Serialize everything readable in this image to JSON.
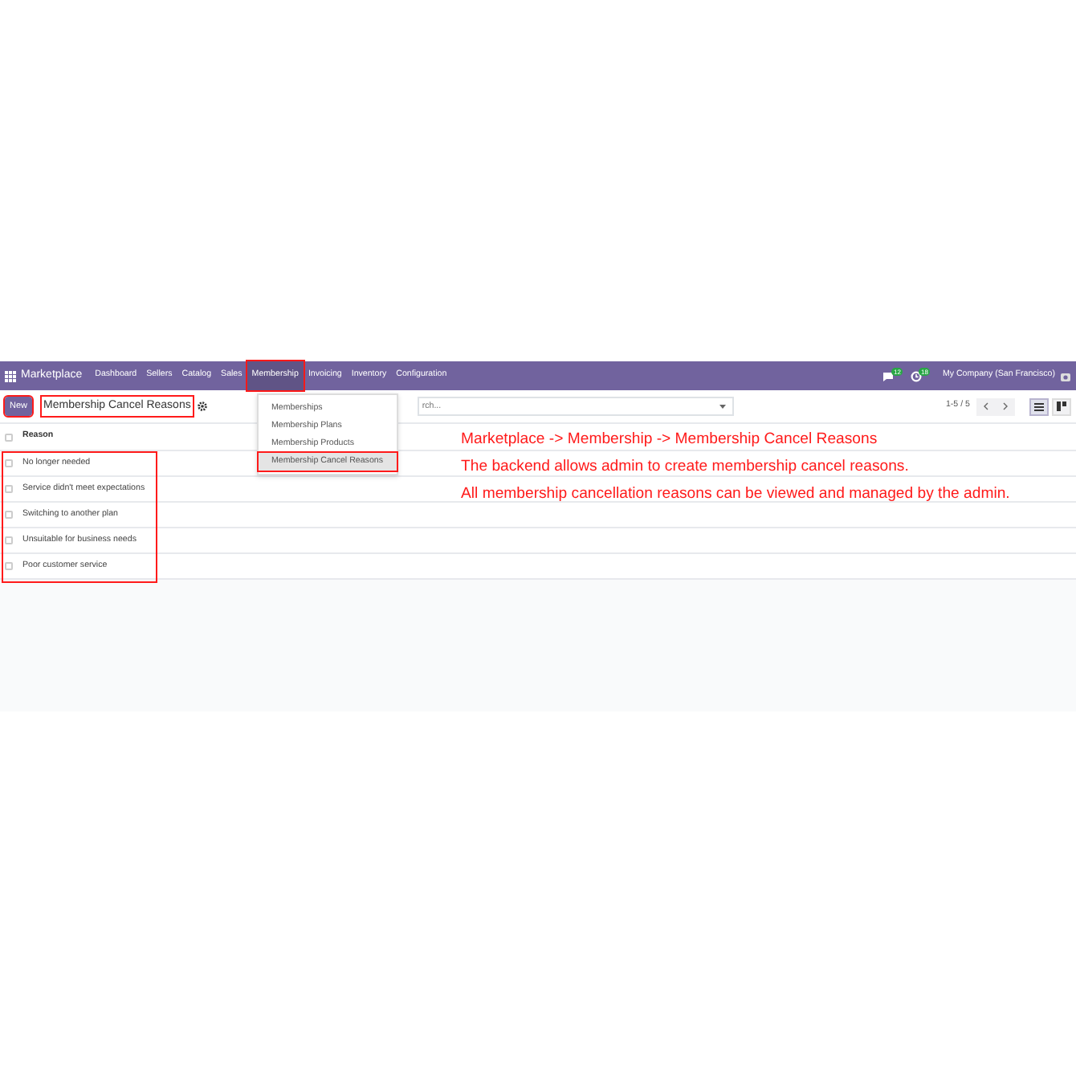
{
  "navbar": {
    "app_name": "Marketplace",
    "menu_items": [
      {
        "label": "Dashboard",
        "selected": false,
        "highlighted": false
      },
      {
        "label": "Sellers",
        "selected": false,
        "highlighted": false
      },
      {
        "label": "Catalog",
        "selected": false,
        "highlighted": false
      },
      {
        "label": "Sales",
        "selected": false,
        "highlighted": false
      },
      {
        "label": "Membership",
        "selected": true,
        "highlighted": true
      },
      {
        "label": "Invoicing",
        "selected": false,
        "highlighted": false
      },
      {
        "label": "Inventory",
        "selected": false,
        "highlighted": false
      },
      {
        "label": "Configuration",
        "selected": false,
        "highlighted": false
      }
    ],
    "badges": [
      "12",
      "18"
    ],
    "company": "My Company (San Francisco)"
  },
  "control_panel": {
    "new_button": {
      "label": "New",
      "highlighted": true
    },
    "title": {
      "text": "Membership Cancel Reasons",
      "highlighted": true
    },
    "search": {
      "placeholder": "rch..."
    },
    "pager": "1-5 / 5",
    "views": [
      {
        "kind": "list",
        "selected": true
      },
      {
        "kind": "kanban",
        "selected": false
      }
    ]
  },
  "dropdown": {
    "items": [
      {
        "label": "Memberships",
        "selected": false,
        "highlighted": false
      },
      {
        "label": "Membership Plans",
        "selected": false,
        "highlighted": false
      },
      {
        "label": "Membership Products",
        "selected": false,
        "highlighted": false
      },
      {
        "label": "Membership Cancel Reasons",
        "selected": true,
        "highlighted": true
      }
    ]
  },
  "table": {
    "columns": [
      "Reason"
    ],
    "all_checked": false,
    "highlighted": true,
    "rows": [
      {
        "reason": "No longer needed",
        "checked": false
      },
      {
        "reason": "Service didn't meet expectations",
        "checked": false
      },
      {
        "reason": "Switching to another plan",
        "checked": false
      },
      {
        "reason": "Unsuitable for business needs",
        "checked": false
      },
      {
        "reason": "Poor customer service",
        "checked": false
      }
    ]
  },
  "annotations": [
    "Marketplace -> Membership -> Membership Cancel Reasons",
    "The backend allows admin to create membership cancel reasons.",
    "All membership cancellation reasons can be viewed and managed by the admin."
  ]
}
